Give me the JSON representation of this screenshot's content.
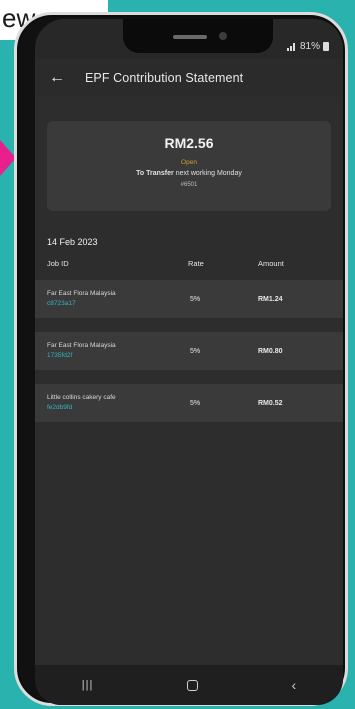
{
  "corner_label": "ew",
  "status_bar": {
    "time": "",
    "battery_pct": "81%"
  },
  "header": {
    "title": "EPF Contribution Statement"
  },
  "summary": {
    "amount": "RM2.56",
    "status": "Open",
    "transfer_bold": "To Transfer",
    "transfer_rest": "next working Monday",
    "reference": "#6501"
  },
  "date_label": "14 Feb 2023",
  "columns": {
    "job_id": "Job ID",
    "rate": "Rate",
    "amount": "Amount"
  },
  "rows": [
    {
      "name": "Far East Flora Malaysia",
      "id": "c8723a17",
      "rate": "5%",
      "amount": "RM1.24"
    },
    {
      "name": "Far East Flora Malaysia",
      "id": "1735fd2f",
      "rate": "5%",
      "amount": "RM0.80"
    },
    {
      "name": "Little collins cakery cafe",
      "id": "fe2db9fd",
      "rate": "5%",
      "amount": "RM0.52"
    }
  ],
  "colors": {
    "background_teal": "#2ab3ae",
    "accent_pink": "#e8208b",
    "status_open": "#d79a3a",
    "job_id_link": "#37b3c0"
  },
  "icons": {
    "back": "back-arrow-icon",
    "recent": "recent-apps-icon",
    "home": "home-icon",
    "nav_back": "nav-back-icon"
  }
}
